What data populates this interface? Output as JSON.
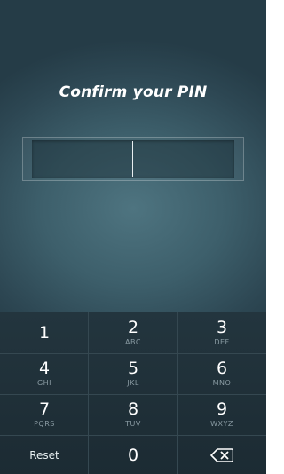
{
  "screen": {
    "title": "Confirm your PIN"
  },
  "pin": {
    "value": ""
  },
  "keypad": {
    "keys": [
      {
        "digit": "1",
        "letters": ""
      },
      {
        "digit": "2",
        "letters": "ABC"
      },
      {
        "digit": "3",
        "letters": "DEF"
      },
      {
        "digit": "4",
        "letters": "GHI"
      },
      {
        "digit": "5",
        "letters": "JKL"
      },
      {
        "digit": "6",
        "letters": "MNO"
      },
      {
        "digit": "7",
        "letters": "PQRS"
      },
      {
        "digit": "8",
        "letters": "TUV"
      },
      {
        "digit": "9",
        "letters": "WXYZ"
      }
    ],
    "reset_label": "Reset",
    "zero_label": "0",
    "backspace_icon": "backspace-icon"
  },
  "colors": {
    "background": "#3d5f6b",
    "keypad": "#1f2f37",
    "text": "#ffffff",
    "subtext": "#8a9ba3"
  }
}
